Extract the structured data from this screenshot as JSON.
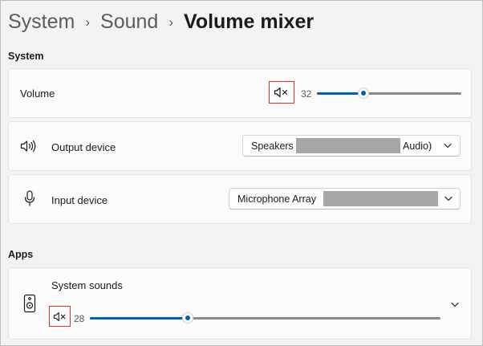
{
  "breadcrumb": {
    "items": [
      "System",
      "Sound",
      "Volume mixer"
    ]
  },
  "system_section": {
    "title": "System",
    "volume": {
      "label": "Volume",
      "value": "32",
      "level": 32,
      "mute_icon": "speaker-mute-icon"
    },
    "output_device": {
      "label": "Output device",
      "icon": "speaker-icon",
      "selected_prefix": "Speakers",
      "selected_suffix": "Audio)"
    },
    "input_device": {
      "label": "Input device",
      "icon": "microphone-icon",
      "selected_prefix": "Microphone Array"
    }
  },
  "apps_section": {
    "title": "Apps",
    "apps": [
      {
        "name": "System sounds",
        "icon": "speaker-device-icon",
        "value": "28",
        "level": 28,
        "mute_icon": "speaker-mute-icon"
      }
    ]
  },
  "colors": {
    "accent": "#005fb8",
    "highlight_box": "#d93025",
    "background": "#f3f3f3",
    "card": "#fbfbfb"
  }
}
